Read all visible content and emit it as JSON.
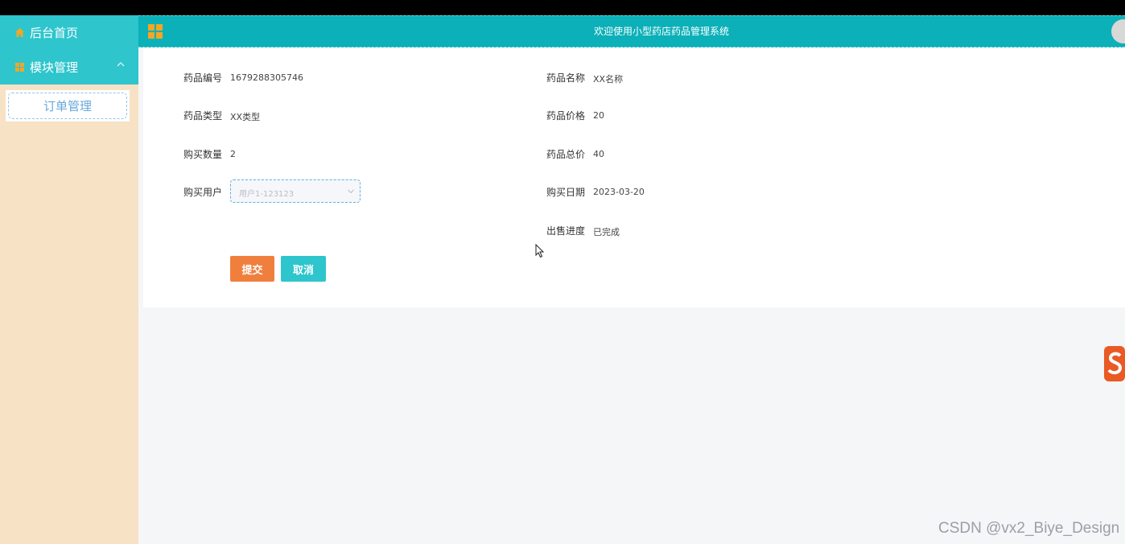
{
  "sidebar": {
    "items": [
      {
        "label": "后台首页",
        "icon": "home-icon"
      },
      {
        "label": "模块管理",
        "icon": "grid-icon"
      }
    ],
    "submenu": [
      {
        "label": "订单管理"
      }
    ]
  },
  "header": {
    "title": "欢迎使用小型药店药品管理系统",
    "menu_icon": "grid-icon"
  },
  "form": {
    "fields": {
      "drug_code": {
        "label": "药品编号",
        "value": "1679288305746"
      },
      "drug_name": {
        "label": "药品名称",
        "value": "XX名称"
      },
      "drug_type": {
        "label": "药品类型",
        "value": "XX类型"
      },
      "drug_price": {
        "label": "药品价格",
        "value": "20"
      },
      "quantity": {
        "label": "购买数量",
        "value": "2"
      },
      "total_price": {
        "label": "药品总价",
        "value": "40"
      },
      "buyer": {
        "label": "购买用户",
        "value": "用户1-123123"
      },
      "purchase_date": {
        "label": "购买日期",
        "value": "2023-03-20"
      },
      "sale_status": {
        "label": "出售进度",
        "value": "已完成"
      }
    },
    "submit_label": "提交",
    "cancel_label": "取消"
  },
  "watermark": "CSDN @vx2_Biye_Design",
  "colors": {
    "teal": "#0bb0b8",
    "sidebar_item": "#2ec5cd",
    "sidebar_bg": "#f7e2c5",
    "submit": "#f07f3e",
    "cancel": "#2ec5cd",
    "icon_orange": "#f5a623"
  }
}
